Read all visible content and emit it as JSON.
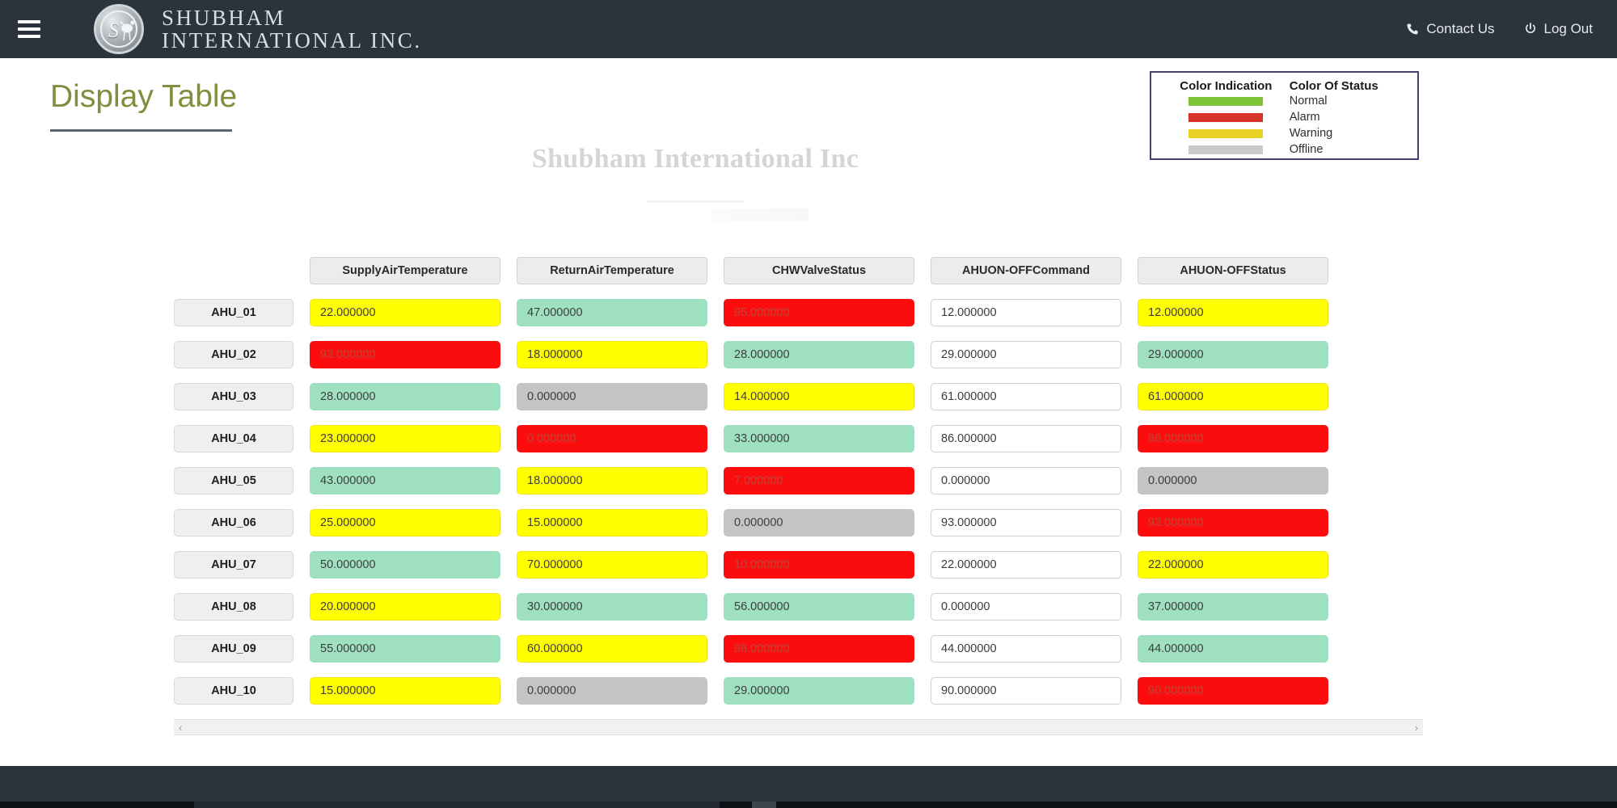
{
  "header": {
    "menu_icon": "hamburger-icon",
    "logo_letter": "S",
    "brand_line1": "SHUBHAM",
    "brand_line2": "INTERNATIONAL INC.",
    "contact_label": "Contact Us",
    "contact_icon": "phone-icon",
    "logout_label": "Log Out",
    "logout_icon": "power-icon"
  },
  "page": {
    "title": "Display Table",
    "watermark": "Shubham International Inc"
  },
  "legend": {
    "col1_header": "Color Indication",
    "col2_header": "Color Of Status",
    "items": [
      {
        "label": "Normal",
        "color": "#7ec338"
      },
      {
        "label": "Alarm",
        "color": "#d8352a"
      },
      {
        "label": "Warning",
        "color": "#e9d226"
      },
      {
        "label": "Offline",
        "color": "#c9c9c9"
      }
    ]
  },
  "table": {
    "columns": [
      "SupplyAirTemperature",
      "ReturnAirTemperature",
      "CHWValveStatus",
      "AHUON-OFFCommand",
      "AHUON-OFFStatus"
    ],
    "rows": [
      {
        "name": "AHU_01",
        "cells": [
          {
            "value": "22.000000",
            "status": "warning"
          },
          {
            "value": "47.000000",
            "status": "normal"
          },
          {
            "value": "95.000000",
            "status": "alarm"
          },
          {
            "value": "12.000000",
            "status": "input"
          },
          {
            "value": "12.000000",
            "status": "warning"
          }
        ]
      },
      {
        "name": "AHU_02",
        "cells": [
          {
            "value": "93.000000",
            "status": "alarm"
          },
          {
            "value": "18.000000",
            "status": "warning"
          },
          {
            "value": "28.000000",
            "status": "normal"
          },
          {
            "value": "29.000000",
            "status": "input"
          },
          {
            "value": "29.000000",
            "status": "normal"
          }
        ]
      },
      {
        "name": "AHU_03",
        "cells": [
          {
            "value": "28.000000",
            "status": "normal"
          },
          {
            "value": "0.000000",
            "status": "offline"
          },
          {
            "value": "14.000000",
            "status": "warning"
          },
          {
            "value": "61.000000",
            "status": "input"
          },
          {
            "value": "61.000000",
            "status": "warning"
          }
        ]
      },
      {
        "name": "AHU_04",
        "cells": [
          {
            "value": "23.000000",
            "status": "warning"
          },
          {
            "value": "0.000000",
            "status": "alarm"
          },
          {
            "value": "33.000000",
            "status": "normal"
          },
          {
            "value": "86.000000",
            "status": "input"
          },
          {
            "value": "86.000000",
            "status": "alarm"
          }
        ]
      },
      {
        "name": "AHU_05",
        "cells": [
          {
            "value": "43.000000",
            "status": "normal"
          },
          {
            "value": "18.000000",
            "status": "warning"
          },
          {
            "value": "7.000000",
            "status": "alarm"
          },
          {
            "value": "0.000000",
            "status": "input"
          },
          {
            "value": "0.000000",
            "status": "offline"
          }
        ]
      },
      {
        "name": "AHU_06",
        "cells": [
          {
            "value": "25.000000",
            "status": "warning"
          },
          {
            "value": "15.000000",
            "status": "warning"
          },
          {
            "value": "0.000000",
            "status": "offline"
          },
          {
            "value": "93.000000",
            "status": "input"
          },
          {
            "value": "93.000000",
            "status": "alarm"
          }
        ]
      },
      {
        "name": "AHU_07",
        "cells": [
          {
            "value": "50.000000",
            "status": "normal"
          },
          {
            "value": "70.000000",
            "status": "warning"
          },
          {
            "value": "10.000000",
            "status": "alarm"
          },
          {
            "value": "22.000000",
            "status": "input"
          },
          {
            "value": "22.000000",
            "status": "warning"
          }
        ]
      },
      {
        "name": "AHU_08",
        "cells": [
          {
            "value": "20.000000",
            "status": "warning"
          },
          {
            "value": "30.000000",
            "status": "normal"
          },
          {
            "value": "56.000000",
            "status": "normal"
          },
          {
            "value": "0.000000",
            "status": "input"
          },
          {
            "value": "37.000000",
            "status": "normal"
          }
        ]
      },
      {
        "name": "AHU_09",
        "cells": [
          {
            "value": "55.000000",
            "status": "normal"
          },
          {
            "value": "60.000000",
            "status": "warning"
          },
          {
            "value": "98.000000",
            "status": "alarm"
          },
          {
            "value": "44.000000",
            "status": "input"
          },
          {
            "value": "44.000000",
            "status": "normal"
          }
        ]
      },
      {
        "name": "AHU_10",
        "cells": [
          {
            "value": "15.000000",
            "status": "warning"
          },
          {
            "value": "0.000000",
            "status": "offline"
          },
          {
            "value": "29.000000",
            "status": "normal"
          },
          {
            "value": "90.000000",
            "status": "input"
          },
          {
            "value": "90.000000",
            "status": "alarm"
          }
        ]
      }
    ]
  },
  "scrollbar": {
    "left_arrow": "‹",
    "right_arrow": "›"
  }
}
